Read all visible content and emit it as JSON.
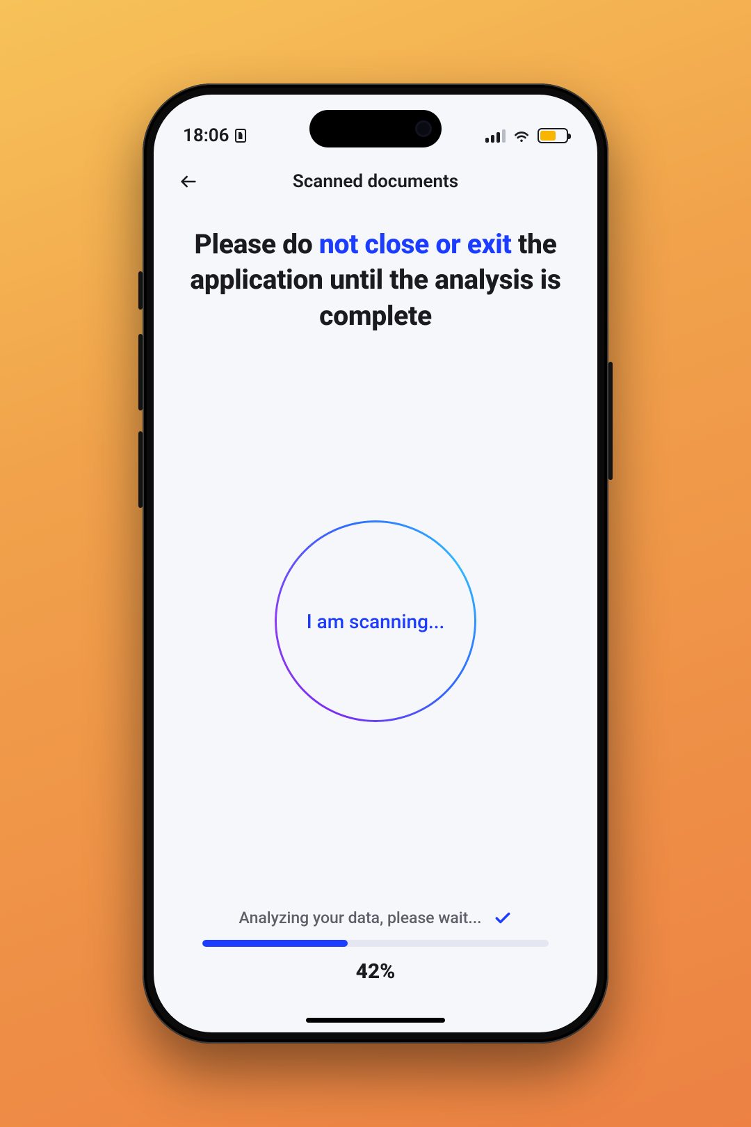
{
  "status": {
    "time": "18:06"
  },
  "nav": {
    "title": "Scanned documents"
  },
  "headline": {
    "part1": "Please do ",
    "highlight": "not close or exit",
    "part2": " the application until the analysis is complete"
  },
  "scan": {
    "label": "I am scanning..."
  },
  "progress": {
    "status_text": "Analyzing your data, please wait...",
    "percent": 42,
    "percent_label": "42%"
  },
  "colors": {
    "accent": "#1c3cff",
    "track": "#e4e7f1",
    "battery_fill": "#f7b500"
  }
}
